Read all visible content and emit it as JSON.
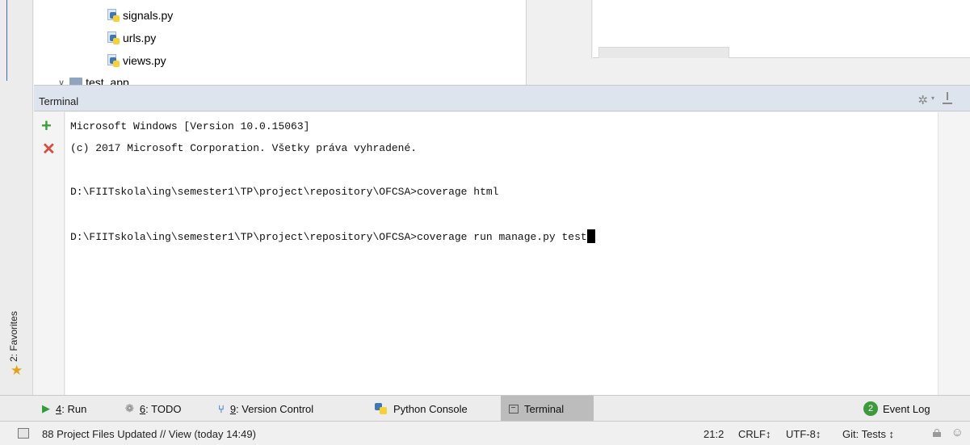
{
  "favorites": {
    "label": "2: Favorites"
  },
  "project_tree": {
    "files": [
      "signals.py",
      "urls.py",
      "views.py"
    ],
    "folder": "test_app"
  },
  "terminal": {
    "title": "Terminal",
    "lines": [
      "Microsoft Windows [Version 10.0.15063]",
      "(c) 2017 Microsoft Corporation. Všetky práva vyhradené.",
      "",
      "D:\\FIITskola\\ing\\semester1\\TP\\project\\repository\\OFCSA>coverage html",
      "",
      "D:\\FIITskola\\ing\\semester1\\TP\\project\\repository\\OFCSA>coverage run manage.py test"
    ]
  },
  "tool_windows": {
    "run": {
      "key": "4",
      "label": ": Run"
    },
    "todo": {
      "key": "6",
      "label": ": TODO"
    },
    "vcs": {
      "key": "9",
      "label": ": Version Control"
    },
    "python_console": "Python Console",
    "terminal": "Terminal",
    "event_log": {
      "count": "2",
      "label": "Event Log"
    }
  },
  "status_bar": {
    "message": "88 Project Files Updated // View (today 14:49)",
    "position": "21:2",
    "line_separator": "CRLF↕",
    "encoding": "UTF-8↕",
    "vcs_branch": "Git: Tests ↕"
  },
  "colors": {
    "accent_green": "#3aa03a",
    "close_red": "#d94b3b",
    "favorites_star": "#e3a21a",
    "terminal_header": "#dde4ee"
  }
}
